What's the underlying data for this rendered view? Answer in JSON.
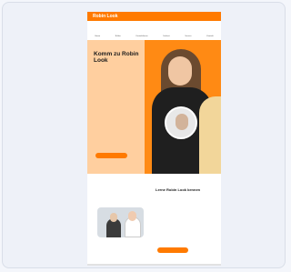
{
  "header": {
    "logo": "Robin Look"
  },
  "nav": {
    "items": [
      "Home",
      "Brillen",
      "Kontaktlinsen",
      "Sehtest",
      "Service",
      "Kontakt"
    ]
  },
  "hero": {
    "title": "Komm zu Robin Look",
    "body": "",
    "cta_label": ""
  },
  "section": {
    "title": "Lerne Robin Look kennen",
    "body": "",
    "body2": "",
    "cta_label": ""
  },
  "colors": {
    "brand": "#ff7a00",
    "hero_bg": "#ffcf9f"
  }
}
